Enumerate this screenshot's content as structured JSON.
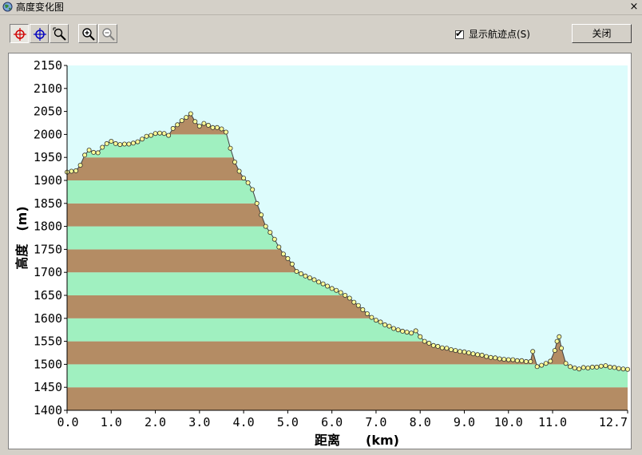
{
  "window": {
    "title": "高度变化图",
    "close_glyph": "×"
  },
  "toolbar": {
    "buttons": [
      {
        "name": "target-red-icon",
        "pressed": true
      },
      {
        "name": "target-blue-icon",
        "pressed": false
      },
      {
        "name": "zoom-select-icon",
        "pressed": false
      },
      {
        "name": "zoom-in-icon",
        "pressed": false
      },
      {
        "name": "zoom-out-icon",
        "pressed": false
      }
    ],
    "show_waypoints": {
      "label": "显示航迹点(S)",
      "checked": true,
      "check_glyph": "✔"
    },
    "close_label": "关闭"
  },
  "colors": {
    "sky": "#ddfcfc",
    "band_green": "#a0f0c0",
    "band_brown": "#b48c64",
    "profile_line": "#404040",
    "marker_fill": "#ffff99"
  },
  "chart_data": {
    "type": "area",
    "xlabel": "距离　　(km)",
    "ylabel": "高度　(m)",
    "xlim": [
      0.0,
      12.7
    ],
    "ylim": [
      1400,
      2150
    ],
    "xticks": [
      "0.0",
      "1.0",
      "2.0",
      "3.0",
      "4.0",
      "5.0",
      "6.0",
      "7.0",
      "8.0",
      "9.0",
      "10.0",
      "11.0",
      "12.7"
    ],
    "yticks": [
      2150,
      2100,
      2050,
      2000,
      1950,
      1900,
      1850,
      1800,
      1750,
      1700,
      1650,
      1600,
      1550,
      1500,
      1450,
      1400
    ],
    "band_step": 50,
    "x": [
      0.0,
      0.1,
      0.2,
      0.3,
      0.4,
      0.5,
      0.6,
      0.7,
      0.8,
      0.9,
      1.0,
      1.1,
      1.2,
      1.3,
      1.4,
      1.5,
      1.6,
      1.7,
      1.8,
      1.9,
      2.0,
      2.1,
      2.2,
      2.3,
      2.4,
      2.5,
      2.6,
      2.7,
      2.8,
      2.9,
      3.0,
      3.1,
      3.2,
      3.3,
      3.4,
      3.5,
      3.6,
      3.7,
      3.8,
      3.9,
      4.0,
      4.1,
      4.2,
      4.3,
      4.4,
      4.5,
      4.6,
      4.7,
      4.8,
      4.9,
      5.0,
      5.1,
      5.2,
      5.3,
      5.4,
      5.5,
      5.6,
      5.7,
      5.8,
      5.9,
      6.0,
      6.1,
      6.2,
      6.3,
      6.4,
      6.5,
      6.6,
      6.7,
      6.8,
      6.9,
      7.0,
      7.1,
      7.2,
      7.3,
      7.4,
      7.5,
      7.6,
      7.7,
      7.8,
      7.9,
      8.0,
      8.1,
      8.2,
      8.3,
      8.4,
      8.5,
      8.6,
      8.7,
      8.8,
      8.9,
      9.0,
      9.1,
      9.2,
      9.3,
      9.4,
      9.5,
      9.6,
      9.7,
      9.8,
      9.9,
      10.0,
      10.1,
      10.2,
      10.3,
      10.4,
      10.5,
      10.55,
      10.65,
      10.75,
      10.85,
      10.95,
      11.05,
      11.1,
      11.15,
      11.2,
      11.3,
      11.4,
      11.5,
      11.6,
      11.7,
      11.8,
      11.9,
      12.0,
      12.1,
      12.2,
      12.3,
      12.4,
      12.5,
      12.6,
      12.7
    ],
    "y": [
      1918,
      1920,
      1921,
      1933,
      1955,
      1966,
      1961,
      1960,
      1972,
      1980,
      1985,
      1980,
      1978,
      1979,
      1979,
      1981,
      1984,
      1990,
      1996,
      1998,
      2002,
      2003,
      2002,
      1998,
      2013,
      2021,
      2030,
      2037,
      2045,
      2028,
      2018,
      2024,
      2020,
      2015,
      2015,
      2012,
      2005,
      1970,
      1940,
      1920,
      1905,
      1895,
      1880,
      1850,
      1825,
      1800,
      1787,
      1772,
      1755,
      1740,
      1730,
      1718,
      1702,
      1697,
      1692,
      1688,
      1684,
      1679,
      1675,
      1670,
      1665,
      1661,
      1656,
      1650,
      1644,
      1635,
      1628,
      1619,
      1610,
      1602,
      1596,
      1592,
      1586,
      1583,
      1578,
      1575,
      1572,
      1570,
      1568,
      1573,
      1560,
      1550,
      1546,
      1541,
      1539,
      1536,
      1535,
      1532,
      1530,
      1528,
      1527,
      1525,
      1523,
      1521,
      1520,
      1517,
      1515,
      1514,
      1512,
      1511,
      1510,
      1510,
      1508,
      1508,
      1506,
      1506,
      1528,
      1495,
      1498,
      1502,
      1507,
      1530,
      1550,
      1560,
      1535,
      1502,
      1495,
      1492,
      1490,
      1493,
      1492,
      1494,
      1494,
      1496,
      1497,
      1494,
      1493,
      1491,
      1490,
      1489
    ]
  }
}
